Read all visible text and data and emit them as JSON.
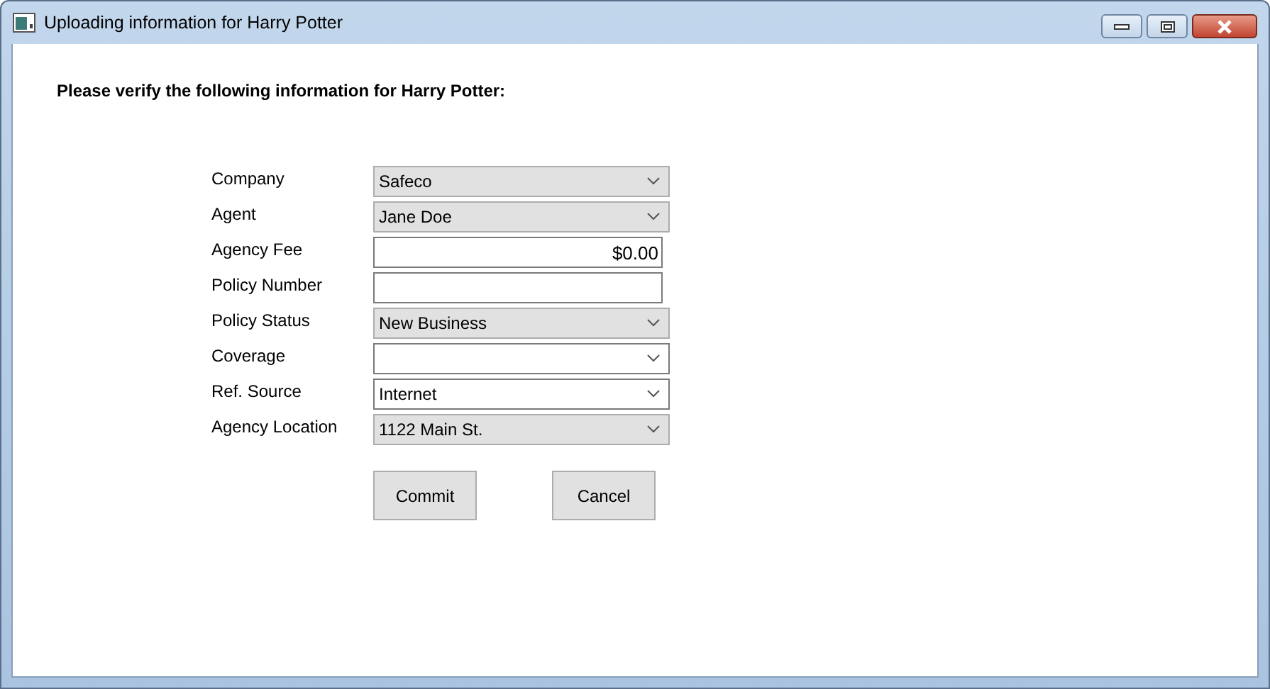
{
  "window": {
    "title": "Uploading information for Harry Potter"
  },
  "heading": "Please verify the following information for Harry Potter:",
  "fields": [
    {
      "label": "Company",
      "kind": "select",
      "value": "Safeco"
    },
    {
      "label": "Agent",
      "kind": "select",
      "value": "Jane Doe"
    },
    {
      "label": "Agency Fee",
      "kind": "amount",
      "value": "$0.00"
    },
    {
      "label": "Policy Number",
      "kind": "text"
    },
    {
      "label": "Policy Status",
      "kind": "select",
      "value": "New Business"
    },
    {
      "label": "Coverage",
      "kind": "combo"
    },
    {
      "label": "Ref. Source",
      "kind": "combo",
      "value": "Internet"
    },
    {
      "label": "Agency Location",
      "kind": "select",
      "value": "1122 Main St."
    }
  ],
  "buttons": [
    "Commit",
    "Cancel"
  ]
}
